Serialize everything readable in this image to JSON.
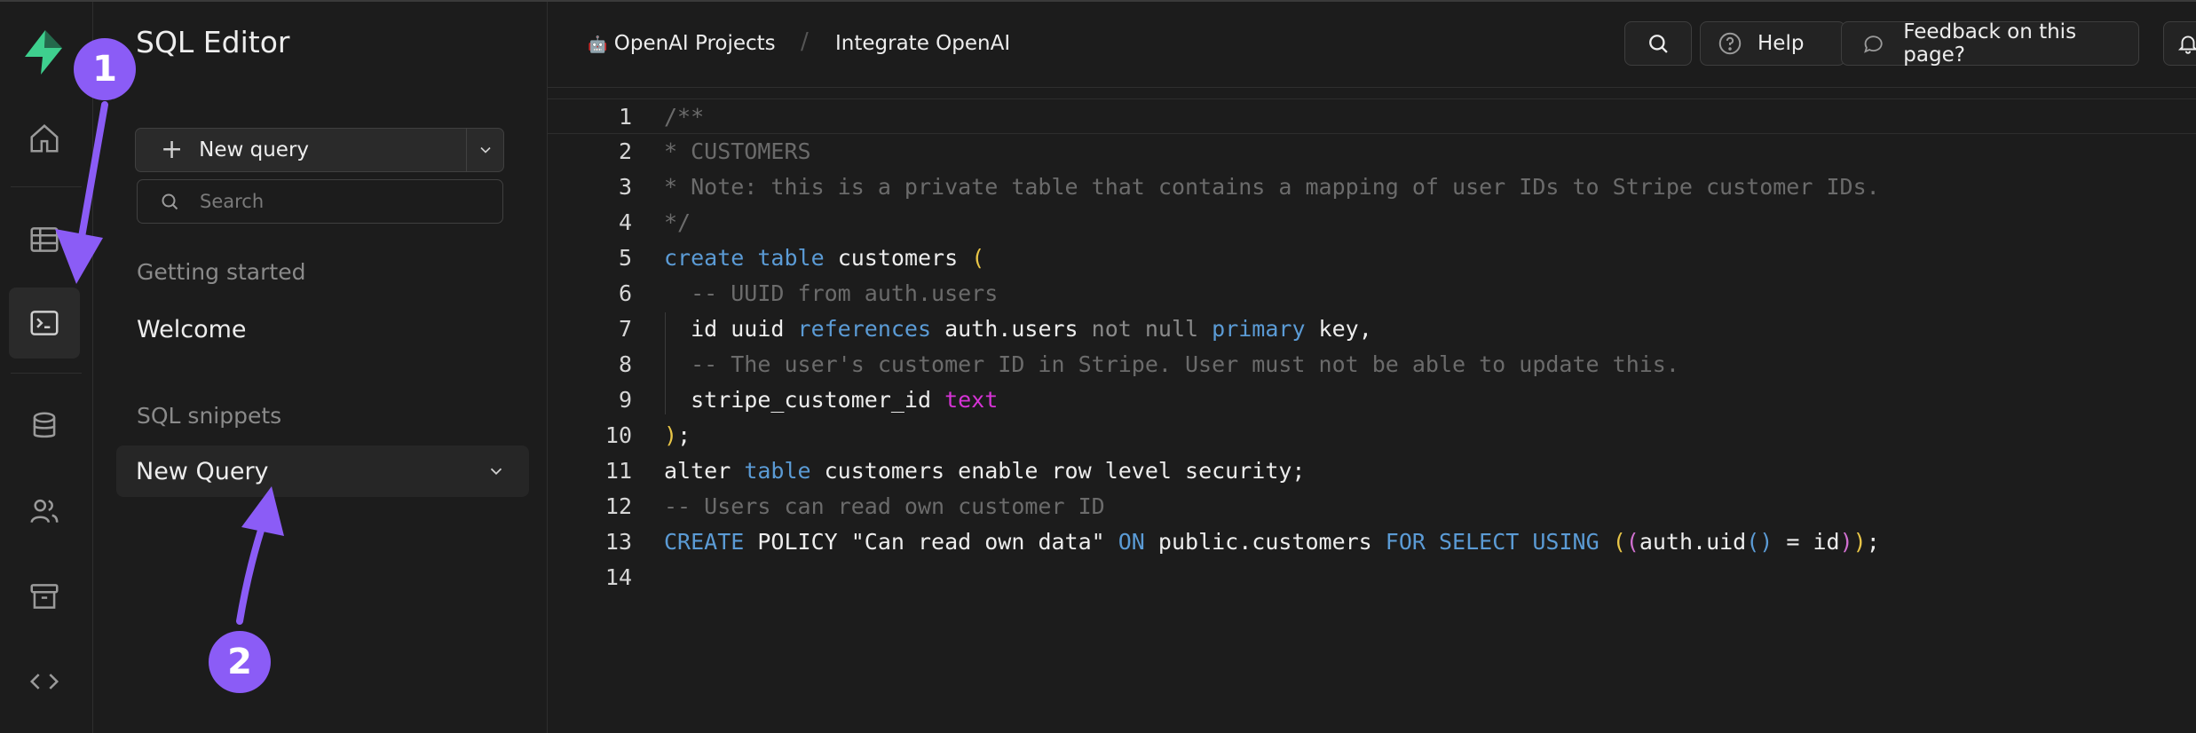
{
  "sidebar": {
    "title": "SQL Editor",
    "new_query_label": "New query",
    "search_placeholder": "Search",
    "section_getting_started": "Getting started",
    "welcome_label": "Welcome",
    "section_snippets": "SQL snippets",
    "snippet_item": "New Query"
  },
  "rail": {
    "icons": [
      "logo-icon",
      "home-icon",
      "table-editor-icon",
      "sql-editor-icon",
      "database-icon",
      "users-icon",
      "storage-icon",
      "api-code-icon"
    ],
    "active": "sql-editor-icon"
  },
  "annotations": {
    "badge_1": "1",
    "badge_2": "2",
    "badge_color": "#8b5cf6"
  },
  "header": {
    "project": "OpenAI Projects",
    "project_emoji": "🤖",
    "page": "Integrate OpenAI",
    "help_label": "Help",
    "feedback_label": "Feedback on this page?"
  },
  "editor": {
    "line_numbers": [
      "1",
      "2",
      "3",
      "4",
      "5",
      "6",
      "7",
      "8",
      "9",
      "10",
      "11",
      "12",
      "13",
      "14"
    ],
    "lines": [
      [
        {
          "t": "/**",
          "c": "c-com"
        }
      ],
      [
        {
          "t": "* CUSTOMERS",
          "c": "c-com"
        }
      ],
      [
        {
          "t": "* Note: this is a private table that contains a mapping of user IDs to Stripe customer IDs.",
          "c": "c-com"
        }
      ],
      [
        {
          "t": "*/",
          "c": "c-com"
        }
      ],
      [
        {
          "t": "create",
          "c": "c-kw"
        },
        {
          "t": " ",
          "c": "c-txt"
        },
        {
          "t": "table",
          "c": "c-kw"
        },
        {
          "t": " customers ",
          "c": "c-txt"
        },
        {
          "t": "(",
          "c": "c-par"
        }
      ],
      [
        {
          "t": "  -- UUID from auth.users",
          "c": "c-com"
        }
      ],
      [
        {
          "t": "  id uuid ",
          "c": "c-txt"
        },
        {
          "t": "references",
          "c": "c-kw"
        },
        {
          "t": " auth.users ",
          "c": "c-txt"
        },
        {
          "t": "not null",
          "c": "c-null"
        },
        {
          "t": " ",
          "c": "c-txt"
        },
        {
          "t": "primary",
          "c": "c-kw"
        },
        {
          "t": " key,",
          "c": "c-txt"
        }
      ],
      [
        {
          "t": "  -- The user's customer ID in Stripe. User must not be able to update this.",
          "c": "c-com"
        }
      ],
      [
        {
          "t": "  stripe_customer_id ",
          "c": "c-txt"
        },
        {
          "t": "text",
          "c": "c-type"
        }
      ],
      [
        {
          "t": ")",
          "c": "c-par"
        },
        {
          "t": ";",
          "c": "c-txt"
        }
      ],
      [
        {
          "t": "alter ",
          "c": "c-txt"
        },
        {
          "t": "table",
          "c": "c-kw"
        },
        {
          "t": " customers enable row level security;",
          "c": "c-txt"
        }
      ],
      [
        {
          "t": "-- Users can read own customer ID",
          "c": "c-com"
        }
      ],
      [
        {
          "t": "CREATE",
          "c": "c-kw"
        },
        {
          "t": " POLICY \"Can read own data\" ",
          "c": "c-txt"
        },
        {
          "t": "ON",
          "c": "c-kw"
        },
        {
          "t": " public.customers ",
          "c": "c-txt"
        },
        {
          "t": "FOR SELECT USING",
          "c": "c-kw"
        },
        {
          "t": " ",
          "c": "c-txt"
        },
        {
          "t": "(",
          "c": "c-par"
        },
        {
          "t": "(",
          "c": "c-par2"
        },
        {
          "t": "auth.uid",
          "c": "c-txt"
        },
        {
          "t": "()",
          "c": "c-par3"
        },
        {
          "t": " = id",
          "c": "c-txt"
        },
        {
          "t": ")",
          "c": "c-par2"
        },
        {
          "t": ")",
          "c": "c-par"
        },
        {
          "t": ";",
          "c": "c-txt"
        }
      ],
      []
    ],
    "current_line": 1
  }
}
